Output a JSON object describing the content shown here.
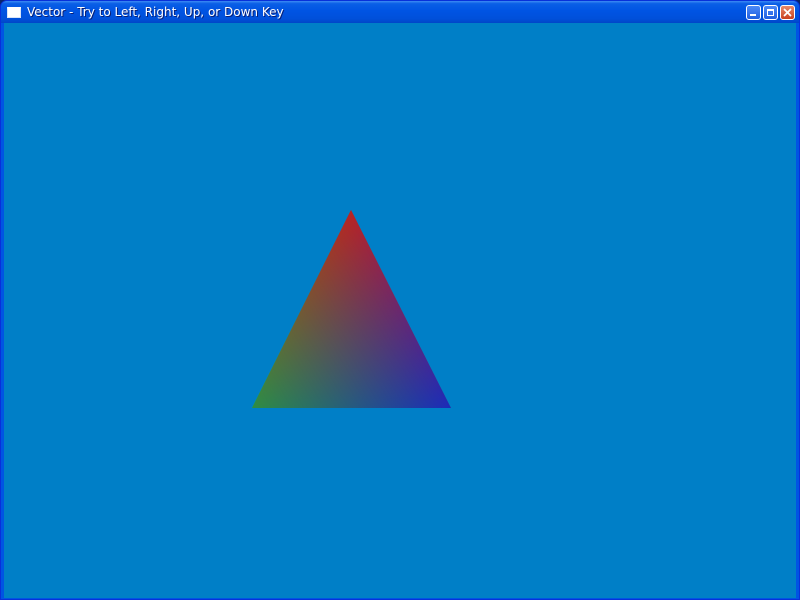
{
  "window": {
    "title": "Vector - Try to Left, Right, Up, or Down Key",
    "title_icon": "application-window-icon",
    "controls": {
      "minimize_icon": "minimize-icon",
      "maximize_icon": "maximize-icon",
      "close_icon": "close-icon"
    }
  },
  "scene": {
    "background_color": "#007fc7",
    "triangle": {
      "vertices": [
        {
          "name": "top",
          "color": "#ff0000"
        },
        {
          "name": "bottom-left",
          "color": "#00ff00"
        },
        {
          "name": "bottom-right",
          "color": "#0000ff"
        }
      ]
    }
  },
  "colors": {
    "titlebar": "#0054e3",
    "title_text": "#ffffff",
    "close_button": "#c9401e"
  }
}
